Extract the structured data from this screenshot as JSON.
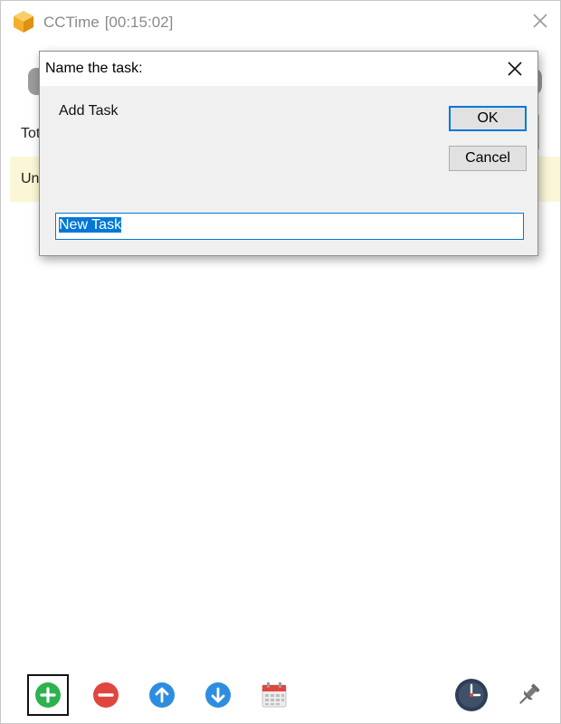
{
  "window": {
    "app_name": "CCTime",
    "timer": "[00:15:02]",
    "close_icon": "close-icon"
  },
  "background": {
    "total_label": "Tot",
    "task_label": "Un"
  },
  "dialog": {
    "title": "Name the task:",
    "prompt": "Add Task",
    "ok_label": "OK",
    "cancel_label": "Cancel",
    "input_value": "New Task"
  },
  "toolbar": {
    "buttons": [
      {
        "icon": "add-icon",
        "color": "#2fb150"
      },
      {
        "icon": "remove-icon",
        "color": "#e0463e"
      },
      {
        "icon": "move-up-icon",
        "color": "#2e8de0"
      },
      {
        "icon": "move-down-icon",
        "color": "#2e8de0"
      },
      {
        "icon": "calendar-icon",
        "color": "#e0463e"
      },
      {
        "icon": "clock-icon",
        "color": "#2e3e55"
      },
      {
        "icon": "pin-icon",
        "color": "#6b6b6b"
      }
    ]
  }
}
